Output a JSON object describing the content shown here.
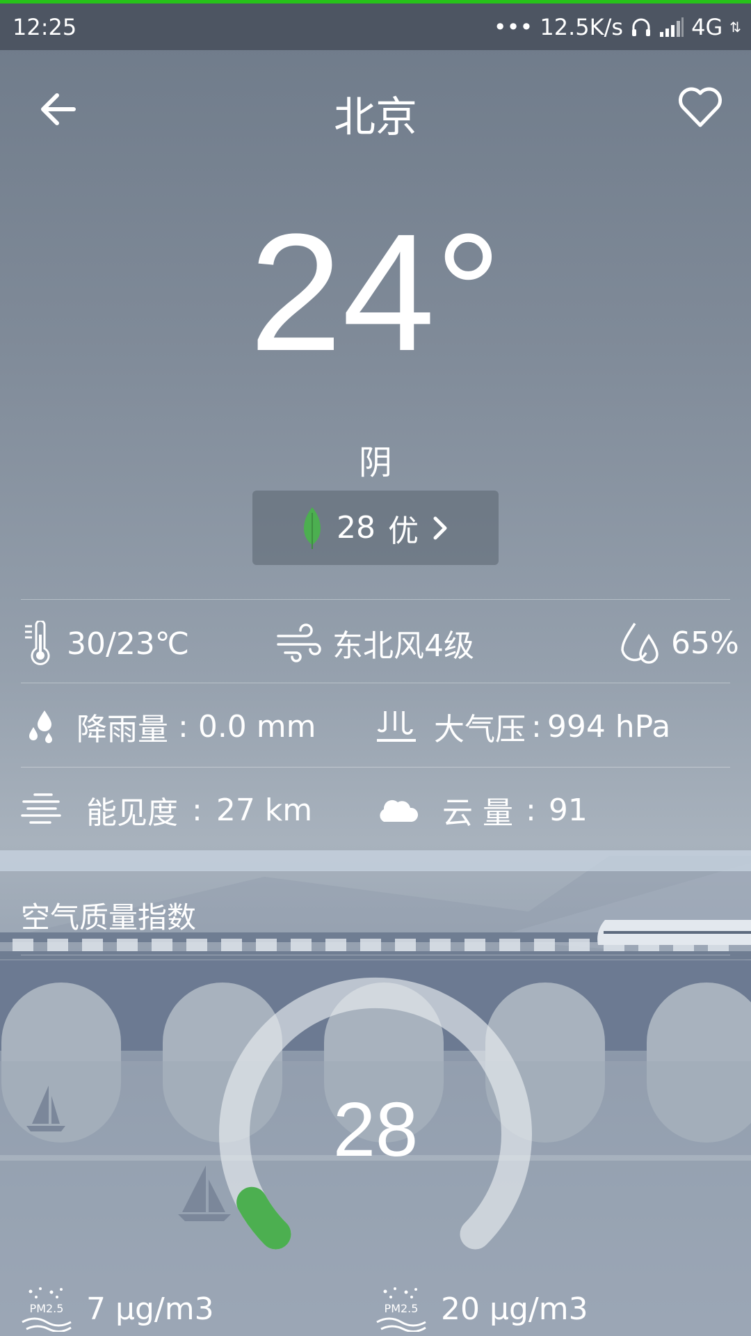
{
  "status_bar": {
    "time": "12:25",
    "network_speed": "12.5K/s",
    "network_type": "4G"
  },
  "header": {
    "city": "北京"
  },
  "current": {
    "temperature": "24°",
    "condition": "阴",
    "aqi_value": "28",
    "aqi_level": "优"
  },
  "details": {
    "temp_range": "30/23℃",
    "wind": "东北风4级",
    "humidity": "65%",
    "precip_label": "降雨量",
    "precip_value": "0.0 mm",
    "pressure_label": "大气压",
    "pressure_value": "994 hPa",
    "visibility_label": "能见度",
    "visibility_value": "27 km",
    "cloud_label": "云 量",
    "cloud_value": "91",
    "separator": ": "
  },
  "air_quality": {
    "title": "空气质量指数",
    "value": "28",
    "gauge_fraction": 0.06,
    "pm25_icon_label": "PM2.5",
    "pm25_value": "7 μg/m3",
    "pm10_icon_label": "PM2.5",
    "pm10_value": "20 μg/m3"
  },
  "colors": {
    "accent_green": "#4caf50",
    "status_green": "#27c21a"
  },
  "icons": [
    "back-arrow-icon",
    "heart-icon",
    "leaf-icon",
    "chevron-right-icon",
    "thermometer-icon",
    "wind-icon",
    "humidity-icon",
    "rain-drops-icon",
    "pressure-icon",
    "visibility-icon",
    "cloud-icon",
    "pm25-icon"
  ]
}
